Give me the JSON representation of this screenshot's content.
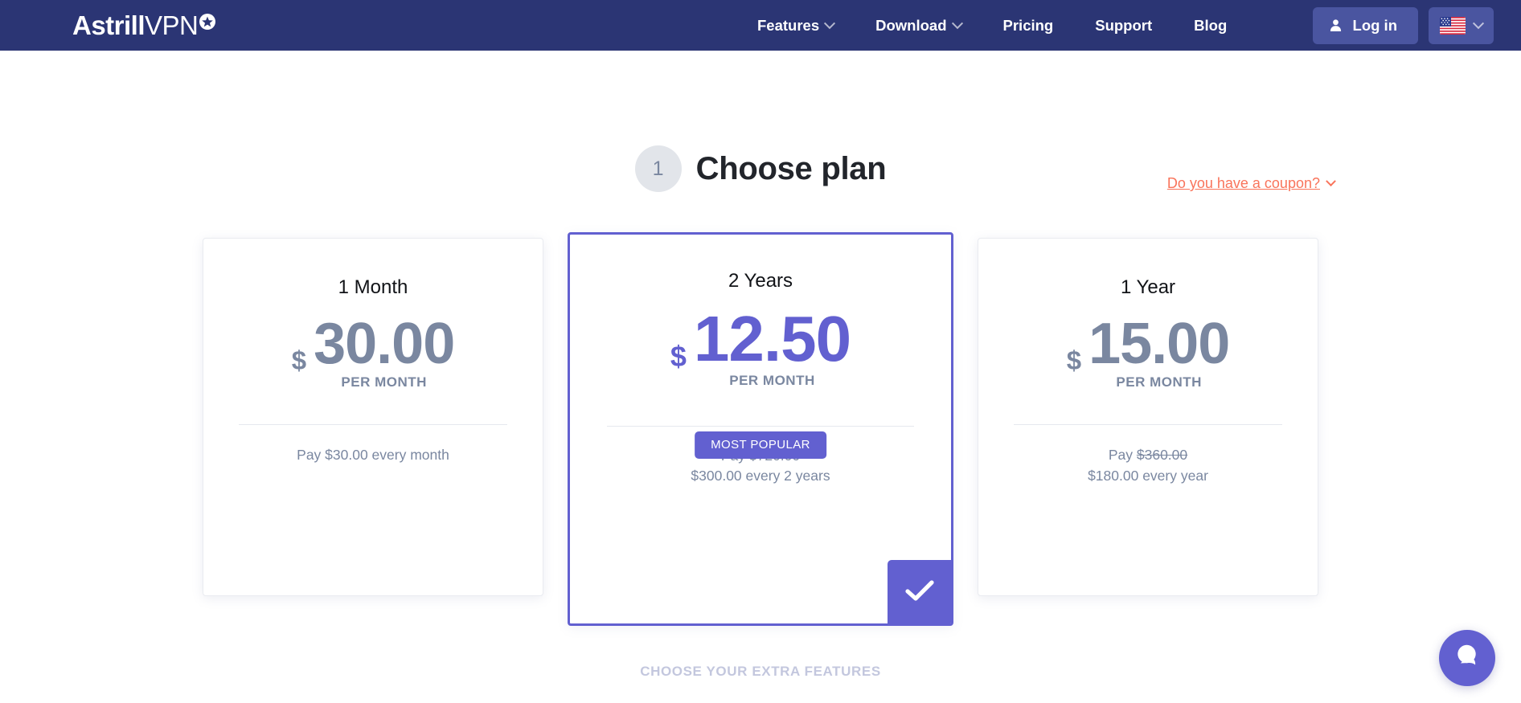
{
  "navbar": {
    "logo": {
      "bold": "Astrill",
      "thin": "VPN",
      "star_icon": "star-badge-icon"
    },
    "links": [
      {
        "label": "Features",
        "has_chevron": true
      },
      {
        "label": "Download",
        "has_chevron": true
      },
      {
        "label": "Pricing",
        "has_chevron": false
      },
      {
        "label": "Support",
        "has_chevron": false
      },
      {
        "label": "Blog",
        "has_chevron": false
      }
    ],
    "login": {
      "label": "Log in",
      "icon": "person-icon"
    },
    "language": {
      "flag": "us-flag-icon",
      "chevron": "chevron-down-icon"
    },
    "background_color": "#2b3574",
    "button_color": "#4a55a0"
  },
  "heading": {
    "step_number": "1",
    "title": "Choose plan",
    "coupon_label": "Do you have a coupon?",
    "coupon_color": "#f9745b"
  },
  "plans": [
    {
      "title": "1 Month",
      "currency": "$",
      "amount": "30.00",
      "per": "PER MONTH",
      "pay_prefix": "Pay ",
      "pay_struck": "",
      "pay_line1_rest": "$30.00 every month",
      "pay_line2": "",
      "featured": false,
      "selected": false
    },
    {
      "title": "2 Years",
      "currency": "$",
      "amount": "12.50",
      "per": "PER MONTH",
      "badge": "MOST POPULAR",
      "pay_prefix": "Pay ",
      "pay_struck": "$720.00",
      "pay_line1_rest": "",
      "pay_line2": "$300.00 every 2 years",
      "featured": true,
      "selected": true,
      "check_icon": "checkmark-icon"
    },
    {
      "title": "1 Year",
      "currency": "$",
      "amount": "15.00",
      "per": "PER MONTH",
      "pay_prefix": "Pay ",
      "pay_struck": "$360.00",
      "pay_line1_rest": "",
      "pay_line2": "$180.00 every year",
      "featured": false,
      "selected": false
    }
  ],
  "footer": {
    "extra_features_label": "CHOOSE YOUR EXTRA FEATURES"
  },
  "chat": {
    "icon": "chat-bubble-icon",
    "color": "#6260d0"
  },
  "colors": {
    "accent_purple": "#6260d0",
    "price_grey": "#7a87a0",
    "navy": "#2b3574"
  }
}
